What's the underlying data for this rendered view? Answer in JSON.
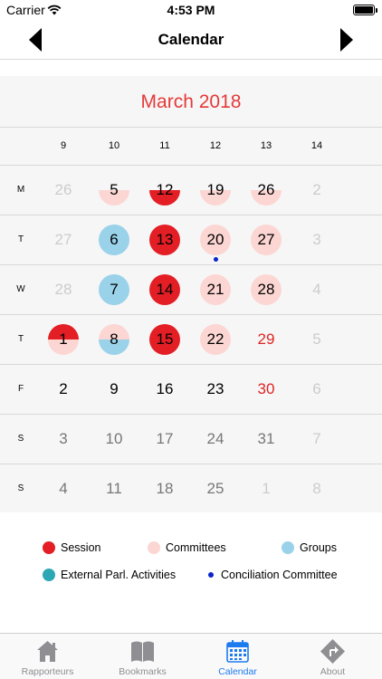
{
  "status_bar": {
    "carrier": "Carrier",
    "time": "4:53 PM"
  },
  "nav": {
    "title": "Calendar"
  },
  "calendar": {
    "month_title": "March 2018",
    "week_numbers": [
      "9",
      "10",
      "11",
      "12",
      "13",
      "14"
    ],
    "day_labels": [
      "M",
      "T",
      "W",
      "T",
      "F",
      "S",
      "S"
    ],
    "rows": [
      [
        {
          "day": "26",
          "style": "muted"
        },
        {
          "day": "5",
          "style": "half-pink"
        },
        {
          "day": "12",
          "style": "half-red"
        },
        {
          "day": "19",
          "style": "half-pink"
        },
        {
          "day": "26",
          "style": "half-pink"
        },
        {
          "day": "2",
          "style": "muted"
        }
      ],
      [
        {
          "day": "27",
          "style": "muted"
        },
        {
          "day": "6",
          "style": "blue"
        },
        {
          "day": "13",
          "style": "red"
        },
        {
          "day": "20",
          "style": "pink",
          "conciliation": true
        },
        {
          "day": "27",
          "style": "pink"
        },
        {
          "day": "3",
          "style": "muted"
        }
      ],
      [
        {
          "day": "28",
          "style": "muted"
        },
        {
          "day": "7",
          "style": "blue"
        },
        {
          "day": "14",
          "style": "red"
        },
        {
          "day": "21",
          "style": "pink"
        },
        {
          "day": "28",
          "style": "pink"
        },
        {
          "day": "4",
          "style": "muted"
        }
      ],
      [
        {
          "day": "1",
          "style": "red-pink"
        },
        {
          "day": "8",
          "style": "pink-blue"
        },
        {
          "day": "15",
          "style": "red"
        },
        {
          "day": "22",
          "style": "pink"
        },
        {
          "day": "29",
          "style": "red-text"
        },
        {
          "day": "5",
          "style": "muted"
        }
      ],
      [
        {
          "day": "2",
          "style": "plain"
        },
        {
          "day": "9",
          "style": "plain"
        },
        {
          "day": "16",
          "style": "plain"
        },
        {
          "day": "23",
          "style": "plain"
        },
        {
          "day": "30",
          "style": "red-text"
        },
        {
          "day": "6",
          "style": "muted"
        }
      ],
      [
        {
          "day": "3",
          "style": "weekend"
        },
        {
          "day": "10",
          "style": "weekend"
        },
        {
          "day": "17",
          "style": "weekend"
        },
        {
          "day": "24",
          "style": "weekend"
        },
        {
          "day": "31",
          "style": "weekend"
        },
        {
          "day": "7",
          "style": "muted"
        }
      ],
      [
        {
          "day": "4",
          "style": "weekend"
        },
        {
          "day": "11",
          "style": "weekend"
        },
        {
          "day": "18",
          "style": "weekend"
        },
        {
          "day": "25",
          "style": "weekend"
        },
        {
          "day": "1",
          "style": "muted"
        },
        {
          "day": "8",
          "style": "muted"
        }
      ]
    ]
  },
  "legend": {
    "session": "Session",
    "committees": "Committees",
    "groups": "Groups",
    "external": "External Parl. Activities",
    "conciliation": "Conciliation Committee"
  },
  "colors": {
    "session": "#e31e24",
    "committees": "#fcd6d3",
    "groups": "#9ad2ea",
    "external": "#2ca8b5",
    "conciliation": "#0a24c9",
    "month_title": "#e53a3a",
    "tab_active": "#1d7bf0"
  },
  "tabs": [
    {
      "label": "Rapporteurs",
      "icon": "house-icon",
      "active": false
    },
    {
      "label": "Bookmarks",
      "icon": "book-icon",
      "active": false
    },
    {
      "label": "Calendar",
      "icon": "calendar-icon",
      "active": true
    },
    {
      "label": "About",
      "icon": "directions-sign-icon",
      "active": false
    }
  ]
}
